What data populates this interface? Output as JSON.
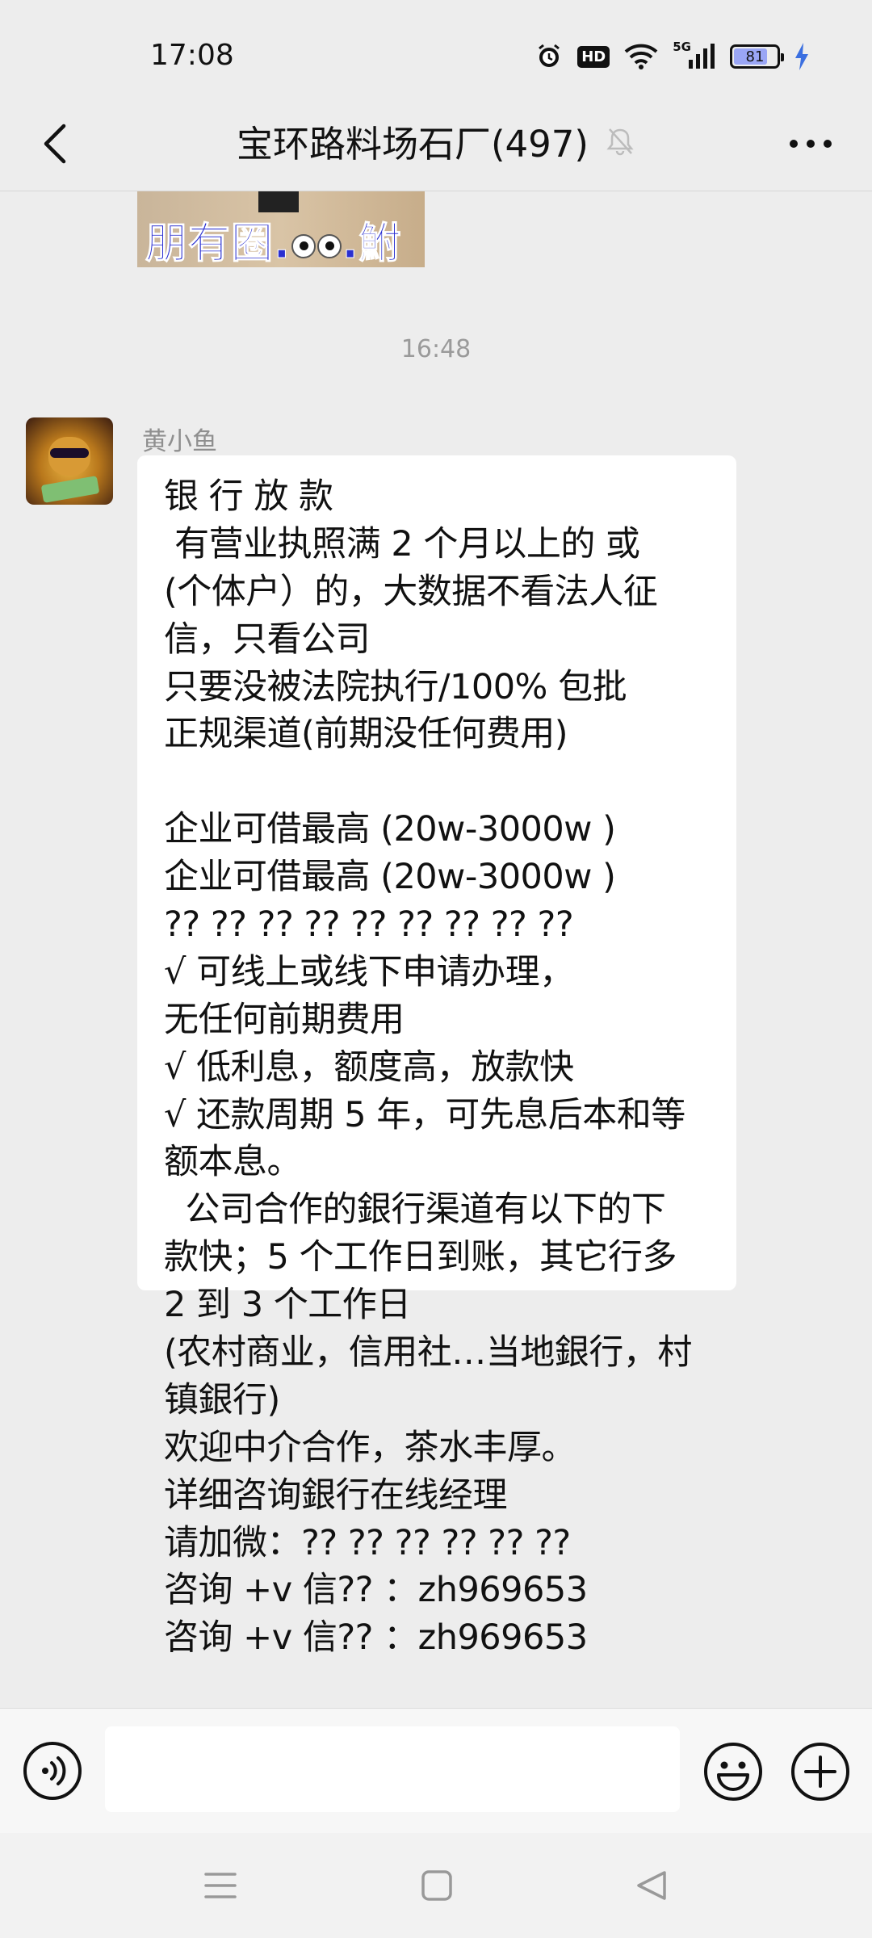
{
  "status_bar": {
    "time": "17:08",
    "network": "5G",
    "hd_label": "HD",
    "battery_level": "81",
    "battery_fraction": 0.81
  },
  "header": {
    "title": "宝环路料场石厂(497)",
    "back_icon": "chevron-left-icon",
    "mute_icon": "bell-off-icon",
    "more_icon": "more-horizontal-icon"
  },
  "chat": {
    "previous_image_text": "朋有圈.",
    "previous_image_text_end": ".鮒",
    "timestamp": "16:48",
    "message": {
      "sender": "黄小鱼",
      "lines": [
        "银 行 放 款",
        " 有营业执照满 2 个月以上的 或",
        "(个体户）的，大数据不看法人征",
        "信，只看公司",
        "只要没被法院执行/100% 包批",
        "正规渠道(前期没任何费用)",
        "",
        "企业可借最高 (20w-3000w )",
        "企业可借最高 (20w-3000w )",
        "?? ?? ?? ?? ?? ?? ?? ?? ??",
        "√ 可线上或线下申请办理，",
        "无任何前期费用",
        "√ 低利息，额度高，放款快",
        "√ 还款周期 5 年，可先息后本和等",
        "额本息。",
        "  公司合作的銀行渠道有以下的下",
        "款快；5 个工作日到账，其它行多",
        "2 到 3 个工作日",
        "(农村商业，信用社…当地銀行，村",
        "镇銀行)",
        "欢迎中介合作，茶水丰厚。",
        "详细咨询銀行在线经理",
        "请加微：?? ?? ?? ?? ?? ??",
        "咨询 +v 信?? ：zh969653",
        "咨询 +v 信?? ：zh969653"
      ]
    }
  },
  "input_bar": {
    "value": "",
    "voice_icon": "voice-icon",
    "emoji_icon": "emoji-icon",
    "plus_icon": "plus-circle-icon"
  },
  "nav_bar": {
    "menu_icon": "menu-icon",
    "home_icon": "home-square-icon",
    "back_icon": "triangle-back-icon"
  }
}
